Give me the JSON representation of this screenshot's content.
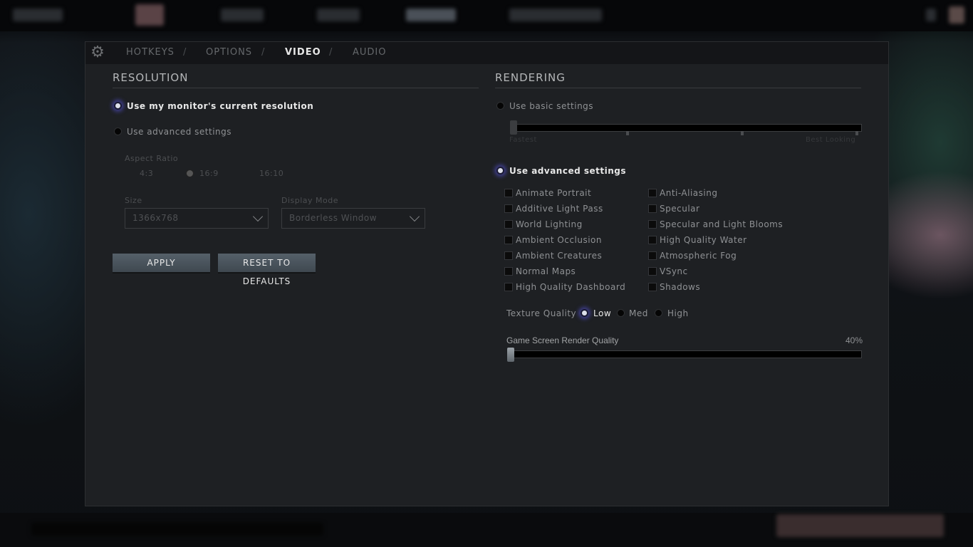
{
  "tabs": [
    {
      "label": "HOTKEYS"
    },
    {
      "label": "OPTIONS"
    },
    {
      "label": "VIDEO",
      "active": true
    },
    {
      "label": "AUDIO"
    }
  ],
  "tab_separator": "/",
  "resolution": {
    "title": "RESOLUTION",
    "use_monitor": "Use my monitor's current resolution",
    "use_advanced": "Use advanced settings",
    "selected": "use_monitor",
    "aspect_label": "Aspect Ratio",
    "aspect_options": [
      "4:3",
      "16:9",
      "16:10"
    ],
    "aspect_selected": "16:9",
    "size_label": "Size",
    "size_value": "1366x768",
    "mode_label": "Display Mode",
    "mode_value": "Borderless Window",
    "apply": "APPLY",
    "reset": "RESET TO DEFAULTS"
  },
  "rendering": {
    "title": "RENDERING",
    "use_basic": "Use basic settings",
    "basic_slider": {
      "min_label": "Fastest",
      "max_label": "Best Looking",
      "value": 0,
      "steps": 4
    },
    "use_advanced": "Use advanced settings",
    "selected": "use_advanced",
    "checkboxes_left": [
      {
        "label": "Animate Portrait",
        "checked": false
      },
      {
        "label": "Additive Light Pass",
        "checked": false
      },
      {
        "label": "World Lighting",
        "checked": false
      },
      {
        "label": "Ambient Occlusion",
        "checked": false
      },
      {
        "label": "Ambient Creatures",
        "checked": false
      },
      {
        "label": "Normal Maps",
        "checked": false
      },
      {
        "label": "High Quality Dashboard",
        "checked": false
      }
    ],
    "checkboxes_right": [
      {
        "label": "Anti-Aliasing",
        "checked": false
      },
      {
        "label": "Specular",
        "checked": false
      },
      {
        "label": "Specular and Light Blooms",
        "checked": false
      },
      {
        "label": "High Quality Water",
        "checked": false
      },
      {
        "label": "Atmospheric Fog",
        "checked": false
      },
      {
        "label": "VSync",
        "checked": false
      },
      {
        "label": "Shadows",
        "checked": false
      }
    ],
    "texture_label": "Texture Quality",
    "texture_options": [
      "Low",
      "Med",
      "High"
    ],
    "texture_selected": "Low",
    "render_quality_label": "Game Screen Render Quality",
    "render_quality_value": "40%",
    "render_quality_percent": 40
  },
  "colors": {
    "accent_glow": "#3e3d8a",
    "panel": "#1e2023",
    "button": "#4a545c"
  }
}
